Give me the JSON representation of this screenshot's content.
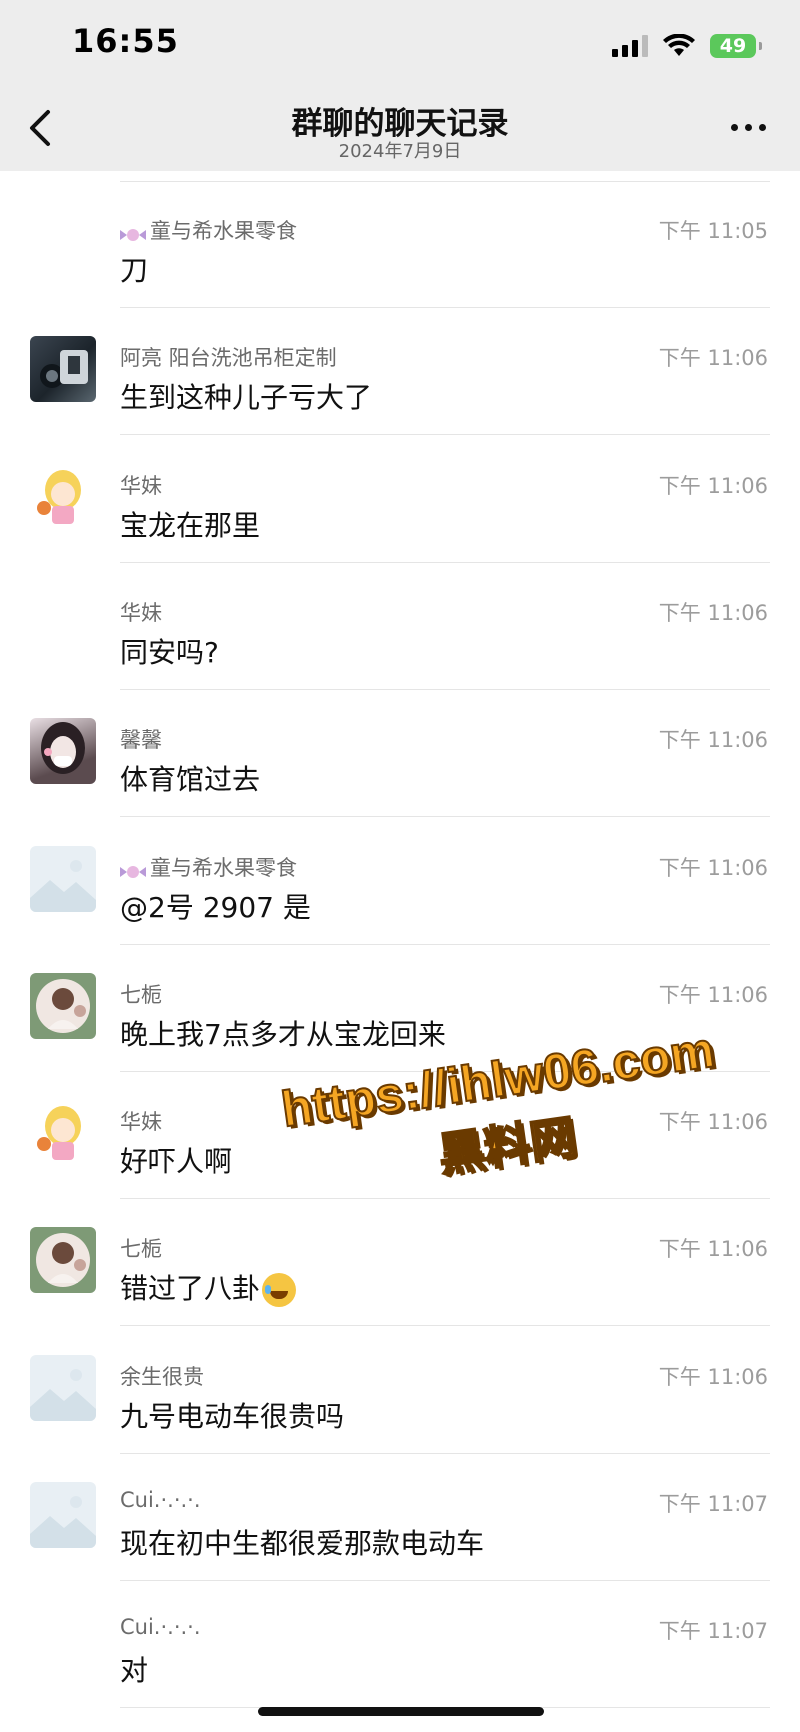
{
  "status_bar": {
    "time": "16:55",
    "battery": "49"
  },
  "nav": {
    "title": "群聊的聊天记录",
    "subtitle": "2024年7月9日"
  },
  "messages": [
    {
      "name": "童与希水果零食",
      "text": "刀",
      "time": "下午 11:05",
      "avatar": "none",
      "name_icon": true
    },
    {
      "name": "阿亮 阳台洗池吊柜定制",
      "text": "生到这种儿子亏大了",
      "time": "下午 11:06",
      "avatar": "photo"
    },
    {
      "name": "华妹",
      "text": "宝龙在那里",
      "time": "下午 11:06",
      "avatar": "girl"
    },
    {
      "name": "华妹",
      "text": "同安吗?",
      "time": "下午 11:06",
      "avatar": "none"
    },
    {
      "name": "馨馨",
      "text": "体育馆过去",
      "time": "下午 11:06",
      "avatar": "mask"
    },
    {
      "name": "童与希水果零食",
      "text": "@2号 2907 是",
      "time": "下午 11:06",
      "avatar": "placeholder",
      "name_icon": true
    },
    {
      "name": "七栀",
      "text": "晚上我7点多才从宝龙回来",
      "time": "下午 11:06",
      "avatar": "green"
    },
    {
      "name": "华妹",
      "text": "好吓人啊",
      "time": "下午 11:06",
      "avatar": "girl"
    },
    {
      "name": "七栀",
      "text": "错过了八卦",
      "time": "下午 11:06",
      "avatar": "green",
      "emoji": true
    },
    {
      "name": "余生很贵",
      "text": "九号电动车很贵吗",
      "time": "下午 11:06",
      "avatar": "placeholder"
    },
    {
      "name": "Cui.·.·.·.",
      "text": "现在初中生都很爱那款电动车",
      "time": "下午 11:07",
      "avatar": "placeholder"
    },
    {
      "name": "Cui.·.·.·.",
      "text": "对",
      "time": "下午 11:07",
      "avatar": "none"
    }
  ],
  "watermark": {
    "url": "https://ihlw06.com",
    "label": "黑料网"
  },
  "colors": {
    "background": "#ffffff",
    "header": "#ededed",
    "battery": "#5bc85b",
    "watermark": "#f5a623"
  }
}
